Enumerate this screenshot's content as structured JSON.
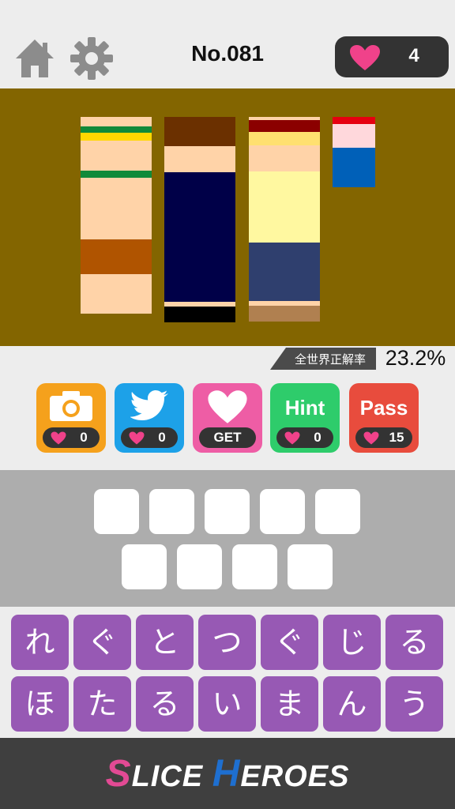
{
  "header": {
    "level_number": "No.081",
    "lives_count": "4",
    "home_icon": "home-icon",
    "settings_icon": "gear-icon",
    "lives_icon": "heart-icon"
  },
  "puzzle": {
    "background_color": "#836500",
    "slices": [
      {
        "colors": [
          "#ffd3a8",
          "#108a3a",
          "#ffd700",
          "#ffd3a8",
          "#108a3a",
          "#ffd3a8",
          "#b05400",
          "#ffd3a8"
        ]
      },
      {
        "colors": [
          "#6b3000",
          "#ffd3a8",
          "#000048",
          "#ffd3a8",
          "#000000"
        ]
      },
      {
        "colors": [
          "#ffd3a8",
          "#8b0000",
          "#ffe070",
          "#ffd3a8",
          "#fff8a0",
          "#2f3f6e",
          "#ffd3a8",
          "#b08050"
        ]
      },
      {
        "colors": [
          "#e60010",
          "#ffd8dc",
          "#0060b8"
        ]
      }
    ]
  },
  "stats": {
    "label": "全世界正解率",
    "value": "23.2%"
  },
  "actions": [
    {
      "name": "camera",
      "icon": "camera-icon",
      "count": "0",
      "color": "#f5a11c"
    },
    {
      "name": "twitter",
      "icon": "twitter-bird-icon",
      "count": "0",
      "color": "#1da1e8"
    },
    {
      "name": "get-hearts",
      "icon": "heart-icon",
      "label": "GET",
      "color": "#ee5da5"
    },
    {
      "name": "hint",
      "label": "Hint",
      "count": "0",
      "color": "#2ecc6b"
    },
    {
      "name": "pass",
      "label": "Pass",
      "count": "15",
      "color": "#e84c3d"
    }
  ],
  "answer_slots": {
    "row1": 5,
    "row2": 4
  },
  "keyboard": {
    "row1": [
      "れ",
      "ぐ",
      "と",
      "つ",
      "ぐ",
      "じ",
      "る"
    ],
    "row2": [
      "ほ",
      "た",
      "る",
      "い",
      "ま",
      "ん",
      "う"
    ]
  },
  "footer": {
    "logo_s": "S",
    "logo_lice": "LICE",
    "logo_h": "H",
    "logo_eroes": "EROES"
  },
  "colors": {
    "accent_heart": "#f0428a",
    "key_purple": "#9759b4",
    "answer_bg": "#adadad"
  }
}
